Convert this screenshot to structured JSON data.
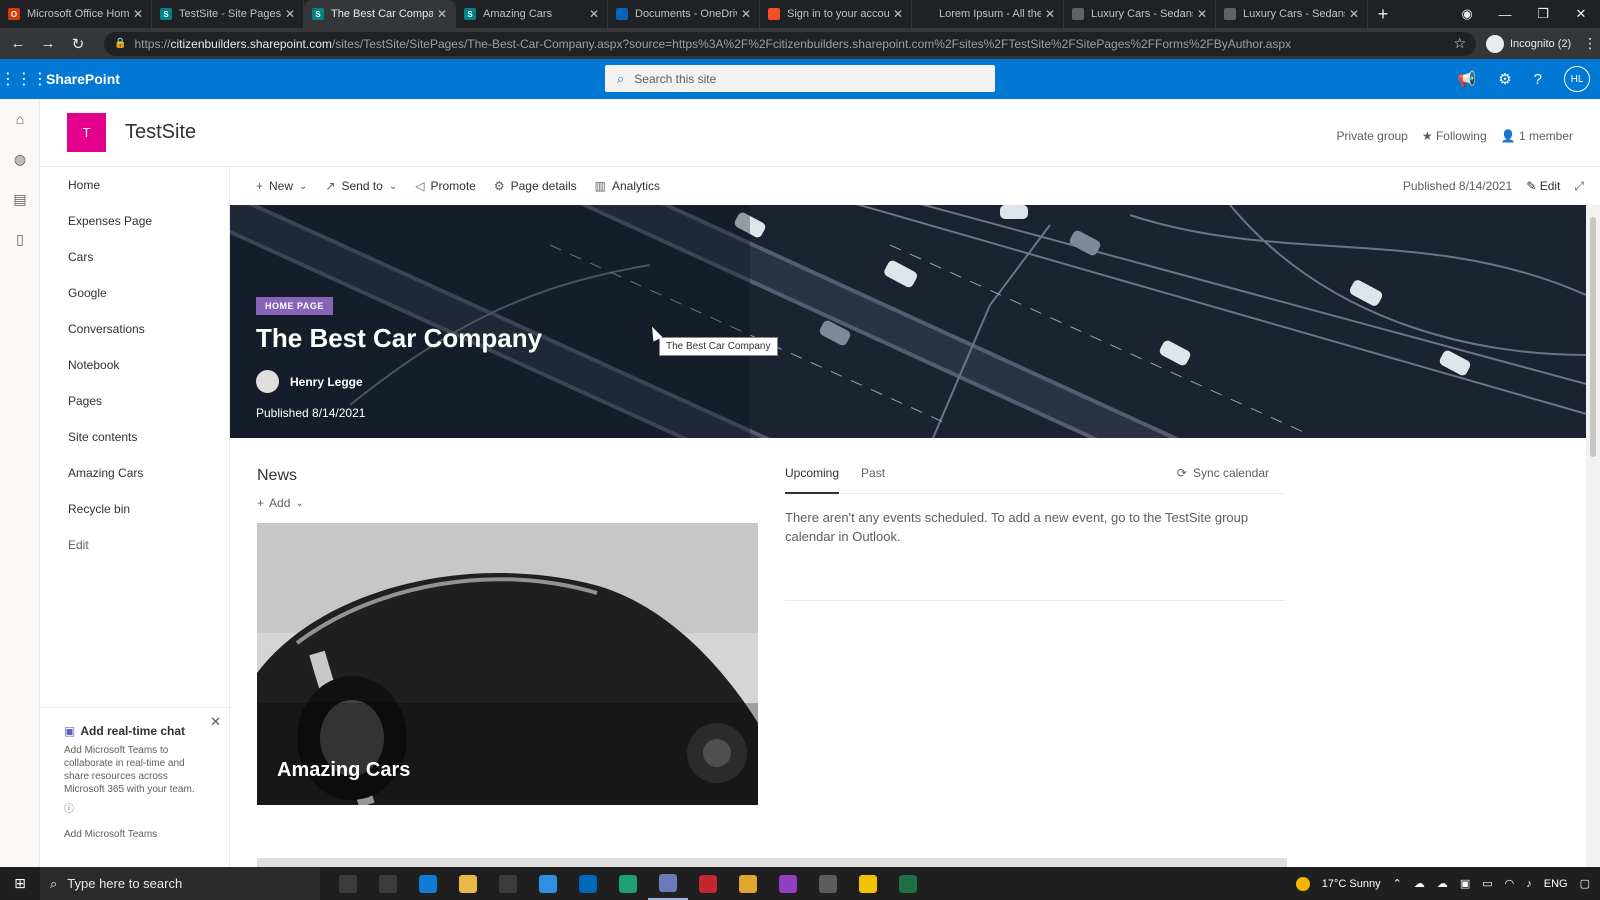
{
  "browser": {
    "tabs": [
      {
        "label": "Microsoft Office Home",
        "color": "#d83b01",
        "glyph": "O",
        "active": false
      },
      {
        "label": "TestSite - Site Pages - ",
        "color": "#038387",
        "glyph": "S",
        "active": false
      },
      {
        "label": "The Best Car Company",
        "color": "#038387",
        "glyph": "S",
        "active": true
      },
      {
        "label": "Amazing Cars",
        "color": "#038387",
        "glyph": "S",
        "active": false
      },
      {
        "label": "Documents - OneDrive",
        "color": "#0364b8",
        "glyph": "",
        "active": false
      },
      {
        "label": "Sign in to your accoun",
        "color": "#f25022",
        "glyph": "",
        "active": false
      },
      {
        "label": "Lorem Ipsum - All the",
        "color": "#202124",
        "glyph": "",
        "active": false
      },
      {
        "label": "Luxury Cars - Sedans,",
        "color": "#5f6368",
        "glyph": "",
        "active": false
      },
      {
        "label": "Luxury Cars - Sedans,",
        "color": "#5f6368",
        "glyph": "",
        "active": false
      }
    ],
    "url_domain": "citizenbuilders.sharepoint.com",
    "url_prefix": "https://",
    "url_path": "/sites/TestSite/SitePages/The-Best-Car-Company.aspx?source=https%3A%2F%2Fcitizenbuilders.sharepoint.com%2Fsites%2FTestSite%2FSitePages%2FForms%2FByAuthor.aspx",
    "profile_label": "Incognito (2)"
  },
  "suite": {
    "brand": "SharePoint",
    "search_placeholder": "Search this site",
    "avatar_initials": "HL"
  },
  "site": {
    "logo_letter": "T",
    "title": "TestSite",
    "privacy": "Private group",
    "following": "Following",
    "members": "1 member"
  },
  "nav": {
    "items": [
      "Home",
      "Expenses Page",
      "Cars",
      "Google",
      "Conversations",
      "Notebook",
      "Pages",
      "Site contents",
      "Amazing Cars",
      "Recycle bin"
    ],
    "edit": "Edit"
  },
  "teams_card": {
    "title": "Add real-time chat",
    "description": "Add Microsoft Teams to collaborate in real-time and share resources across Microsoft 365 with your team.",
    "link": "Add Microsoft Teams"
  },
  "command_bar": {
    "new": "New",
    "send_to": "Send to",
    "promote": "Promote",
    "page_details": "Page details",
    "analytics": "Analytics",
    "published": "Published 8/14/2021",
    "edit": "Edit"
  },
  "hero": {
    "badge": "HOME PAGE",
    "title": "The Best Car Company",
    "author": "Henry Legge",
    "published": "Published 8/14/2021",
    "tooltip": "The Best Car Company"
  },
  "news": {
    "title": "News",
    "add": "Add",
    "card_title": "Amazing Cars"
  },
  "events": {
    "tab_upcoming": "Upcoming",
    "tab_past": "Past",
    "sync": "Sync calendar",
    "message": "There aren't any events scheduled. To add a new event, go to the TestSite group calendar in Outlook."
  },
  "taskbar": {
    "search_placeholder": "Type here to search",
    "weather": "17°C  Sunny",
    "language": "ENG",
    "app_colors": [
      "#3c3c3c",
      "#3c3c3c",
      "#0f7bd6",
      "#e8b84a",
      "#3c3c3c",
      "#2f8fe0",
      "#0068b8",
      "#1e9e75",
      "#6b7ab8",
      "#c4262e",
      "#e0a62e",
      "#8f3fbf",
      "#5c5c5c",
      "#f2c200",
      "#1e7145"
    ]
  }
}
